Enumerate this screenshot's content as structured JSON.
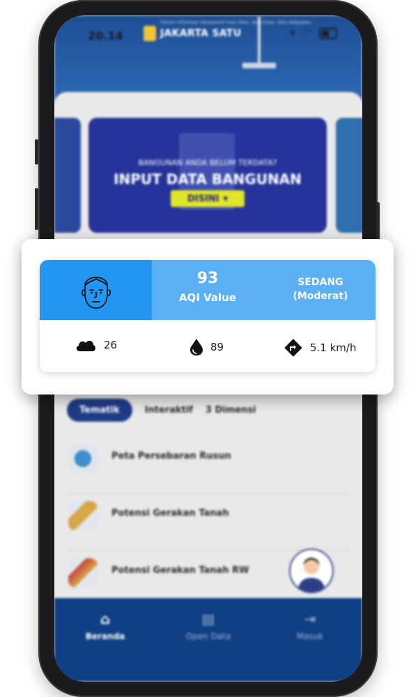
{
  "status_bar": {
    "time": "20.14"
  },
  "brand": {
    "name": "JAKARTA SATU",
    "subtitle": "Sistem Informasi Geospasial Satu Peta, Satu Data, Satu Kebijakan"
  },
  "banner": {
    "question": "BANGUNAN ANDA BELUM TERDATA?",
    "title": "INPUT DATA BANGUNAN",
    "button_label": "DISINI"
  },
  "aqi": {
    "value": "93",
    "value_label": "AQI Value",
    "status_line1": "SEDANG",
    "status_line2": "(Moderat)",
    "header_color": "#5ab0f3",
    "face_block_color": "#2196f3",
    "stats": [
      {
        "icon": "cloud-icon",
        "value": "26"
      },
      {
        "icon": "water-drop-icon",
        "value": "89"
      },
      {
        "icon": "wind-direction-icon",
        "value": "5.1 km/h"
      }
    ]
  },
  "tabs": [
    {
      "label": "Tematik",
      "active": true
    },
    {
      "label": "Interaktif",
      "active": false
    },
    {
      "label": "3 Dimensi",
      "active": false
    }
  ],
  "menu": [
    {
      "label": "Peta Persebaran Rusun",
      "icon": "globe-map-icon"
    },
    {
      "label": "Potensi Gerakan Tanah",
      "icon": "terrain-map-icon"
    },
    {
      "label": "Potensi Gerakan Tanah RW",
      "icon": "terrain-map-icon"
    }
  ],
  "bottom_nav": [
    {
      "label": "Beranda",
      "icon": "home-icon",
      "active": true
    },
    {
      "label": "Open Data",
      "icon": "document-icon",
      "active": false
    },
    {
      "label": "Masuk",
      "icon": "login-icon",
      "active": false
    }
  ]
}
